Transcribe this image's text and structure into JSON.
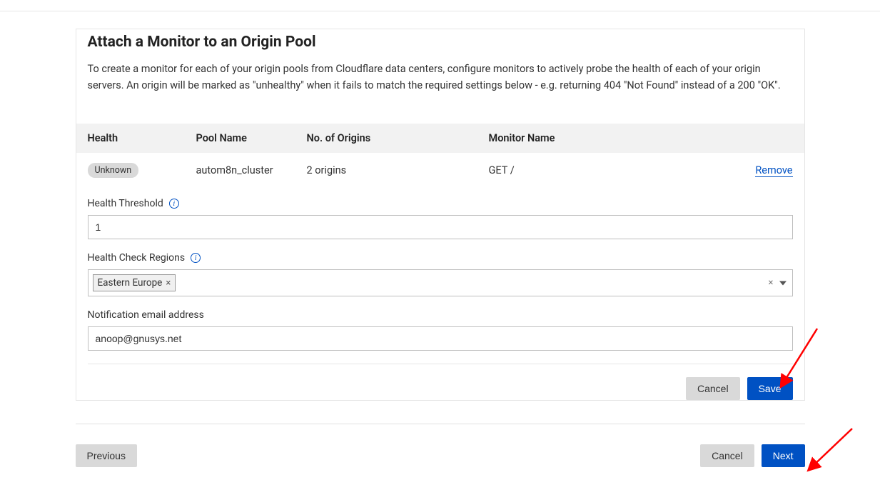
{
  "page": {
    "title": "Attach a Monitor to an Origin Pool",
    "description": "To create a monitor for each of your origin pools from Cloudflare data centers, configure monitors to actively probe the health of each of your origin servers. An origin will be marked as \"unhealthy\" when it fails to match the required settings below - e.g. returning 404 \"Not Found\" instead of a 200 \"OK\"."
  },
  "table": {
    "headers": {
      "health": "Health",
      "pool": "Pool Name",
      "origins": "No. of Origins",
      "monitor": "Monitor Name"
    },
    "row": {
      "health_status": "Unknown",
      "pool_name": "autom8n_cluster",
      "origins_count": "2 origins",
      "monitor_name": "GET /",
      "remove_label": "Remove"
    }
  },
  "form": {
    "health_threshold": {
      "label": "Health Threshold",
      "value": "1"
    },
    "health_check_regions": {
      "label": "Health Check Regions",
      "selected_tag": "Eastern Europe"
    },
    "notification_email": {
      "label": "Notification email address",
      "value": "anoop@gnusys.net"
    }
  },
  "buttons": {
    "cancel": "Cancel",
    "save": "Save",
    "previous": "Previous",
    "next": "Next"
  }
}
